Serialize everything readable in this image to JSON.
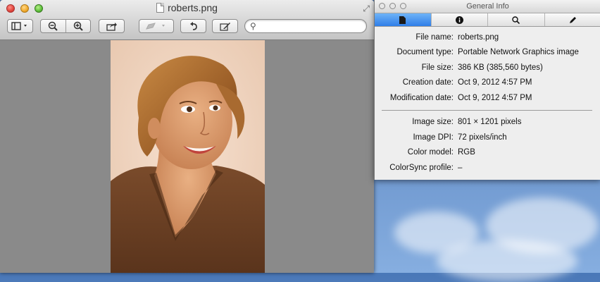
{
  "preview": {
    "title": "roberts.png",
    "search": {
      "value": "",
      "placeholder": ""
    }
  },
  "info": {
    "title": "General Info",
    "tabs": [
      {
        "icon": "document-icon",
        "glyph": "▘"
      },
      {
        "icon": "info-icon",
        "glyph": "ⓘ"
      },
      {
        "icon": "keyword-search-icon",
        "glyph": "⌕"
      },
      {
        "icon": "annotations-pen-icon",
        "glyph": "✎"
      }
    ],
    "file_name": {
      "label": "File name:",
      "value": "roberts.png"
    },
    "document_type": {
      "label": "Document type:",
      "value": "Portable Network Graphics image"
    },
    "file_size": {
      "label": "File size:",
      "value": "386 KB (385,560 bytes)"
    },
    "creation_date": {
      "label": "Creation date:",
      "value": "Oct 9, 2012 4:57 PM"
    },
    "modification_date": {
      "label": "Modification date:",
      "value": "Oct 9, 2012 4:57 PM"
    },
    "image_size": {
      "label": "Image size:",
      "value": "801 × 1201 pixels"
    },
    "image_dpi": {
      "label": "Image DPI:",
      "value": "72 pixels/inch"
    },
    "color_model": {
      "label": "Color model:",
      "value": "RGB"
    },
    "colorsync_profile": {
      "label": "ColorSync profile:",
      "value": "–"
    }
  }
}
